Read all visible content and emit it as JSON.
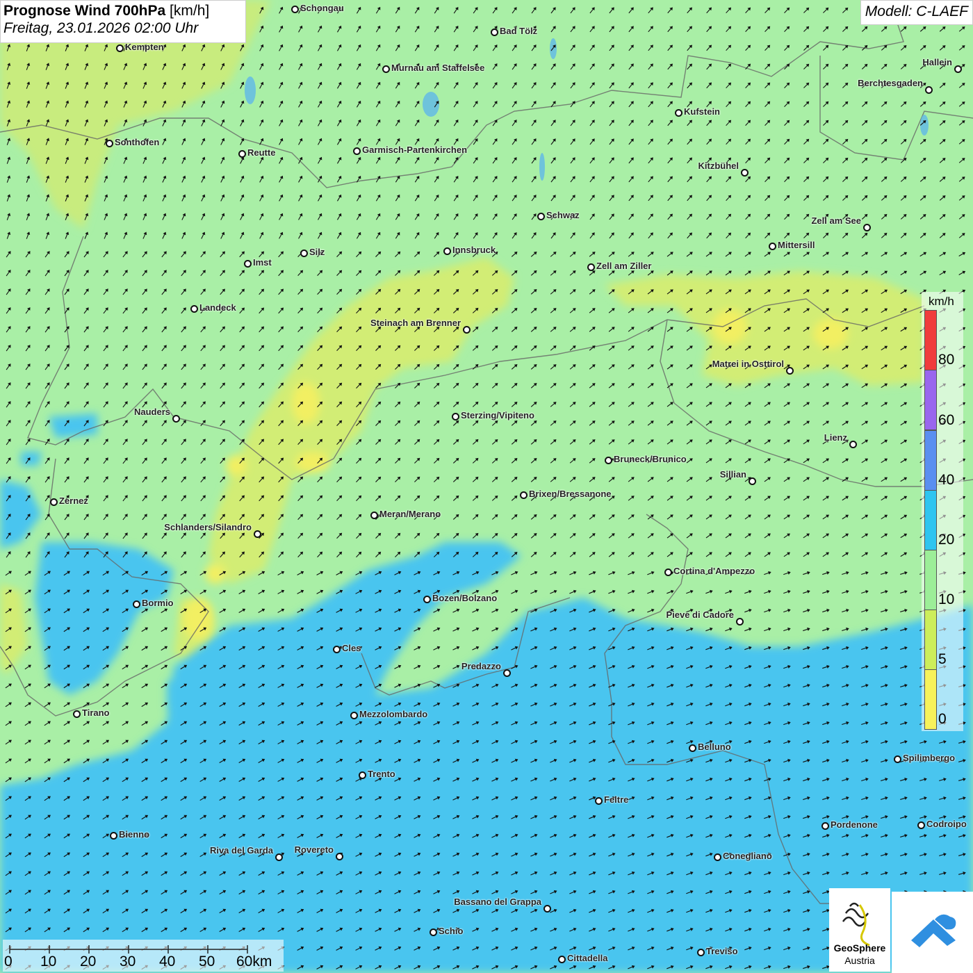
{
  "title": {
    "main_bold": "Prognose Wind 700hPa",
    "main_unit": "[km/h]",
    "datetime": "Freitag, 23.01.2026 02:00 Uhr"
  },
  "model": "Modell: C-LAEF",
  "legend": {
    "unit": "km/h",
    "ticks": [
      "80",
      "60",
      "40",
      "20",
      "10",
      "5",
      "0"
    ],
    "colors": [
      "#f03c3c",
      "#9966ee",
      "#5a8ff0",
      "#2ec5f0",
      "#9cee98",
      "#cdee5a",
      "#f7f25a"
    ]
  },
  "scale_bar": {
    "ticks": [
      "0",
      "10",
      "20",
      "30",
      "40",
      "50",
      "60km"
    ]
  },
  "cities": [
    {
      "name": "Schongau"
    },
    {
      "name": "Bad Tölz"
    },
    {
      "name": "Kempten"
    },
    {
      "name": "Murnau am Staffelsee"
    },
    {
      "name": "Hallein"
    },
    {
      "name": "Berchtesgaden"
    },
    {
      "name": "Kufstein"
    },
    {
      "name": "Sonthofen"
    },
    {
      "name": "Reutte"
    },
    {
      "name": "Garmisch-Partenkirchen"
    },
    {
      "name": "Kitzbühel"
    },
    {
      "name": "Schwaz"
    },
    {
      "name": "Zell am See"
    },
    {
      "name": "Mittersill"
    },
    {
      "name": "Innsbruck"
    },
    {
      "name": "Silz"
    },
    {
      "name": "Imst"
    },
    {
      "name": "Zell am Ziller"
    },
    {
      "name": "Landeck"
    },
    {
      "name": "Steinach am Brenner"
    },
    {
      "name": "Matrei in Osttirol"
    },
    {
      "name": "Nauders"
    },
    {
      "name": "Sterzing/Vipiteno"
    },
    {
      "name": "Lienz"
    },
    {
      "name": "Bruneck/Brunico"
    },
    {
      "name": "Sillian"
    },
    {
      "name": "Zernez"
    },
    {
      "name": "Brixen/Bressanone"
    },
    {
      "name": "Meran/Merano"
    },
    {
      "name": "Schlanders/Silandro"
    },
    {
      "name": "Cortina d'Ampezzo"
    },
    {
      "name": "Bozen/Bolzano"
    },
    {
      "name": "Bormio"
    },
    {
      "name": "Pieve di Cadore"
    },
    {
      "name": "Cles"
    },
    {
      "name": "Predazzo"
    },
    {
      "name": "Tirano"
    },
    {
      "name": "Mezzolombardo"
    },
    {
      "name": "Belluno"
    },
    {
      "name": "Spilimbergo"
    },
    {
      "name": "Trento"
    },
    {
      "name": "Feltre"
    },
    {
      "name": "Bienno"
    },
    {
      "name": "Pordenone"
    },
    {
      "name": "Codroipo"
    },
    {
      "name": "Riva del Garda"
    },
    {
      "name": "Rovereto"
    },
    {
      "name": "Conegliano"
    },
    {
      "name": "Bassano del Grappa"
    },
    {
      "name": "Schio"
    },
    {
      "name": "Treviso"
    },
    {
      "name": "Cittadella"
    }
  ],
  "logo": {
    "line1": "GeoSphere",
    "line2": "Austria"
  }
}
